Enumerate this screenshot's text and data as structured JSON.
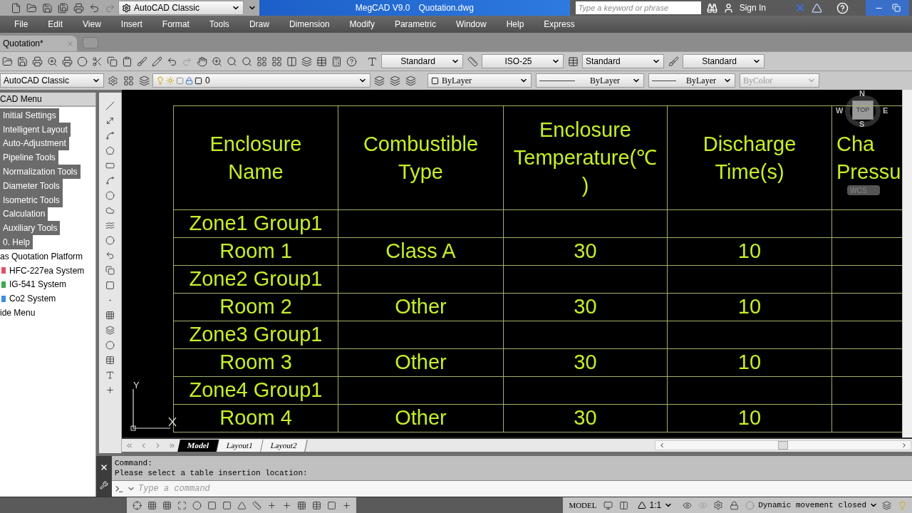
{
  "title_bar": {
    "workspace": "AutoCAD Classic",
    "app": "MegCAD V9.0",
    "file": "Quotation.dwg",
    "search": {
      "placeholder": "Type a keyword or phrase"
    },
    "sign_in": "Sign In"
  },
  "menu": [
    "File",
    "Edit",
    "View",
    "Insert",
    "Format",
    "Tools",
    "Draw",
    "Dimension",
    "Modify",
    "Parametric",
    "Window",
    "Help",
    "Express"
  ],
  "doc_tabs": [
    {
      "label": "Quotation*",
      "selected": true
    }
  ],
  "style_toolbar": [
    "Standard",
    "ISO-25",
    "Standard",
    "Standard"
  ],
  "props_toolbar": {
    "workspace": "AutoCAD Classic",
    "layer": "0",
    "color_setting": "ByLayer",
    "linetype": "ByLayer",
    "lineweight": "ByLayer",
    "plot_style": "ByColor"
  },
  "side_panel": {
    "title": "CAD Menu",
    "items": [
      {
        "label": "Initial Settings",
        "selected": true
      },
      {
        "label": "Intelligent Layout",
        "selected": true
      },
      {
        "label": "Auto-Adjustment",
        "selected": true
      },
      {
        "label": "Pipeline Tools",
        "selected": true
      },
      {
        "label": "Normalization Tools",
        "selected": true
      },
      {
        "label": "Diameter Tools",
        "selected": true
      },
      {
        "label": "Isometric Tools",
        "selected": true
      },
      {
        "label": "Calculation",
        "selected": true
      },
      {
        "label": "Auxiliary Tools",
        "selected": true
      },
      {
        "label": "0. Help",
        "selected": true
      },
      {
        "label": "as Quotation Platform",
        "selected": false,
        "children": [
          {
            "label": "HFC-227ea System",
            "selected": false,
            "color": "#e0506a"
          },
          {
            "label": "IG-541 System",
            "selected": false,
            "color": "#3caa50"
          },
          {
            "label": "Co2 System",
            "selected": false,
            "color": "#3c8ce0"
          }
        ]
      },
      {
        "label": "ide Menu",
        "selected": false
      }
    ]
  },
  "table": {
    "columns": [
      {
        "lines": [
          "Enclosure",
          "Name"
        ]
      },
      {
        "lines": [
          "Combustible",
          "Type"
        ]
      },
      {
        "lines": [
          "Enclosure",
          "Temperature(℃",
          ")"
        ]
      },
      {
        "lines": [
          "Discharge",
          "Time(s)"
        ]
      },
      {
        "lines": [
          "Cha",
          "Pressu"
        ]
      }
    ],
    "rows": [
      {
        "cells": [
          "Zone1 Group1"
        ]
      },
      {
        "cells": [
          "Room 1",
          "Class A",
          "30",
          "10"
        ]
      },
      {
        "cells": [
          "Zone2 Group1"
        ]
      },
      {
        "cells": [
          "Room 2",
          "Other",
          "30",
          "10"
        ]
      },
      {
        "cells": [
          "Zone3 Group1"
        ]
      },
      {
        "cells": [
          "Room 3",
          "Other",
          "30",
          "10"
        ]
      },
      {
        "cells": [
          "Zone4 Group1"
        ]
      },
      {
        "cells": [
          "Room 4",
          "Other",
          "30",
          "10"
        ]
      }
    ]
  },
  "compass": {
    "north": "N",
    "west": "W",
    "east": "E",
    "south": "S",
    "view": "TOP",
    "ucs": "WCS"
  },
  "ucs_axis": {
    "y": "Y"
  },
  "layout_tabs": [
    {
      "label": "Model",
      "selected": true
    },
    {
      "label": "Layout1",
      "selected": false
    },
    {
      "label": "Layout2",
      "selected": false
    }
  ],
  "command": {
    "history": [
      "Command:",
      "Please select a table insertion location:"
    ],
    "placeholder": "Type a command"
  },
  "status_bar": {
    "mode": "MODEL",
    "scale": "1:1",
    "dynamic": "Dynamic movement closed"
  }
}
